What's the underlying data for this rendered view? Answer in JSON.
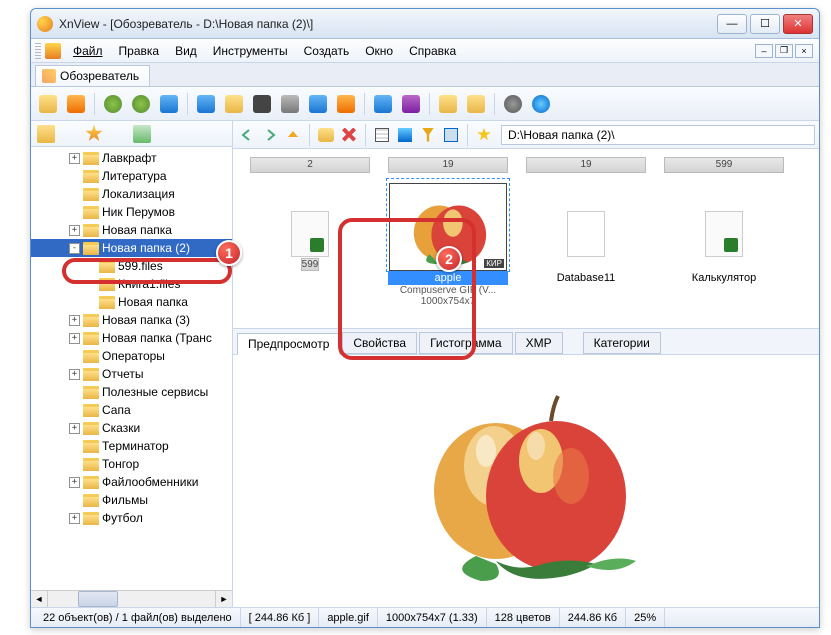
{
  "window": {
    "title": "XnView - [Обозреватель - D:\\Новая папка (2)\\]"
  },
  "menu": {
    "items": [
      "Файл",
      "Правка",
      "Вид",
      "Инструменты",
      "Создать",
      "Окно",
      "Справка"
    ]
  },
  "browser_tab": {
    "label": "Обозреватель"
  },
  "location": {
    "path": "D:\\Новая папка (2)\\"
  },
  "tree": {
    "items": [
      {
        "label": "Лавкрафт",
        "depth": 2,
        "exp": "+"
      },
      {
        "label": "Литература",
        "depth": 2,
        "exp": ""
      },
      {
        "label": "Локализация",
        "depth": 2,
        "exp": ""
      },
      {
        "label": "Ник Перумов",
        "depth": 2,
        "exp": ""
      },
      {
        "label": "Новая папка",
        "depth": 2,
        "exp": "+"
      },
      {
        "label": "Новая папка (2)",
        "depth": 2,
        "exp": "-",
        "selected": true
      },
      {
        "label": "599.files",
        "depth": 3,
        "exp": ""
      },
      {
        "label": "Книга1.files",
        "depth": 3,
        "exp": ""
      },
      {
        "label": "Новая папка",
        "depth": 3,
        "exp": ""
      },
      {
        "label": "Новая папка (3)",
        "depth": 2,
        "exp": "+"
      },
      {
        "label": "Новая папка (Транс",
        "depth": 2,
        "exp": "+"
      },
      {
        "label": "Операторы",
        "depth": 2,
        "exp": ""
      },
      {
        "label": "Отчеты",
        "depth": 2,
        "exp": "+"
      },
      {
        "label": "Полезные сервисы",
        "depth": 2,
        "exp": ""
      },
      {
        "label": "Сапа",
        "depth": 2,
        "exp": ""
      },
      {
        "label": "Сказки",
        "depth": 2,
        "exp": "+"
      },
      {
        "label": "Терминатор",
        "depth": 2,
        "exp": ""
      },
      {
        "label": "Тонгор",
        "depth": 2,
        "exp": ""
      },
      {
        "label": "Файлообменники",
        "depth": 2,
        "exp": "+"
      },
      {
        "label": "Фильмы",
        "depth": 2,
        "exp": ""
      },
      {
        "label": "Футбол",
        "depth": 2,
        "exp": "+"
      }
    ]
  },
  "thumbs": {
    "row1": [
      {
        "header": "2"
      },
      {
        "header": "19"
      },
      {
        "header": "19"
      },
      {
        "header": "599"
      }
    ],
    "row2": [
      {
        "header": "599",
        "name": "",
        "type": "excel"
      },
      {
        "header": "",
        "name": "apple",
        "meta1": "Compuserve GIF (V...",
        "meta2": "1000x754x7",
        "type": "image",
        "selected": true
      },
      {
        "header": "",
        "name": "Database11",
        "type": "file"
      },
      {
        "header": "",
        "name": "Калькулятор",
        "type": "excel"
      }
    ]
  },
  "preview_tabs": {
    "items": [
      "Предпросмотр",
      "Свойства",
      "Гистограмма",
      "XMP"
    ],
    "detached": "Категории"
  },
  "status": {
    "cells": [
      "22 объект(ов) / 1 файл(ов) выделено",
      "[ 244.86 Кб ]",
      "apple.gif",
      "1000x754x7 (1.33)",
      "128 цветов",
      "244.86 Кб",
      "25%"
    ]
  },
  "callouts": {
    "b1": "1",
    "b2": "2"
  }
}
